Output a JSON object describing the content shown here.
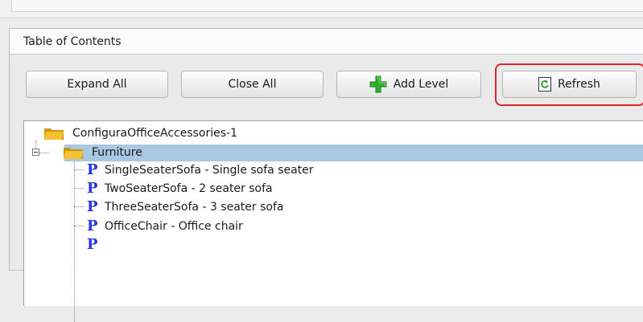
{
  "panel": {
    "title": "Table of Contents"
  },
  "toolbar": {
    "expand_all": "Expand All",
    "close_all": "Close All",
    "add_level": "Add Level",
    "refresh": "Refresh"
  },
  "tree": {
    "root": {
      "label": "ConfiguraOfficeAccessories-1",
      "icon": "folder-icon"
    },
    "folder": {
      "label": "Furniture",
      "icon": "folder-icon",
      "expanded": true,
      "selected": true
    },
    "items": [
      {
        "label": "SingleSeaterSofa - Single sofa seater",
        "icon": "P"
      },
      {
        "label": "TwoSeaterSofa - 2 seater sofa",
        "icon": "P"
      },
      {
        "label": "ThreeSeaterSofa - 3 seater sofa",
        "icon": "P"
      },
      {
        "label": "OfficeChair - Office chair",
        "icon": "P"
      }
    ]
  },
  "colors": {
    "highlight": "#e0262d",
    "selected_row": "#a8c8e3",
    "product_icon": "#1f36e0",
    "folder": "#f2c230"
  }
}
